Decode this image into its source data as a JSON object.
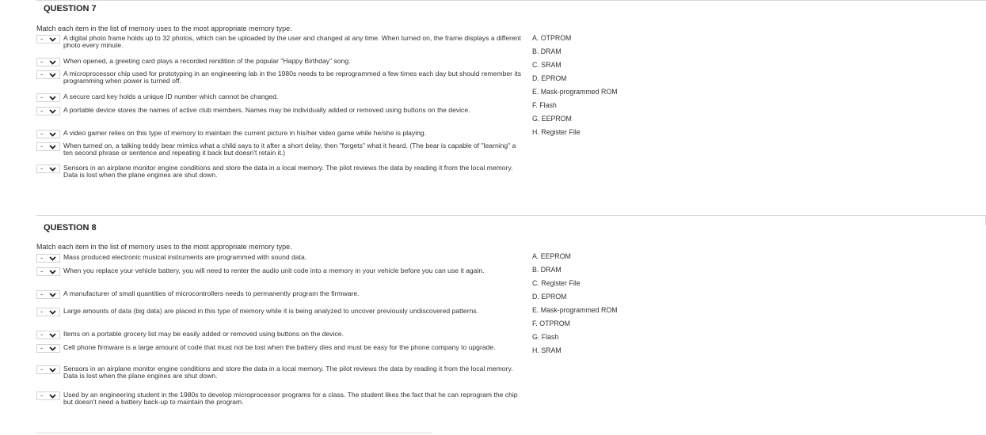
{
  "q7": {
    "title": "QUESTION 7",
    "instruction": "Match each item in the list of memory uses to the most appropriate memory type.",
    "items": [
      {
        "sel": "-",
        "text": "A digital photo frame holds up to 32 photos, which can be uploaded by the user and changed at any time. When turned on, the frame displays a different photo every minute."
      },
      {
        "sel": "-",
        "text": "When opened, a greeting card plays a recorded rendition of the popular \"Happy Birthday\" song."
      },
      {
        "sel": "-",
        "text": "A microprocessor chip used for prototyping in an engineering lab in the 1980s needs to be reprogrammed a few times each day but should remember its programming when power is turned off."
      },
      {
        "sel": "-",
        "text": "A secure card key holds a unique ID number which cannot be changed."
      },
      {
        "sel": "-",
        "text": "A portable device stores the names of active club members. Names may be individually added or removed using buttons on the device."
      },
      {
        "sel": "-",
        "text": "A video gamer relies on this type of memory to maintain the current picture in his/her video game while he/she is playing."
      },
      {
        "sel": "-",
        "text": "When turned on, a talking teddy bear mimics what a child says to it after a short delay, then \"forgets\" what it heard. (The bear is capable of \"learning\" a ten second phrase or sentence and repeating it back but doesn't retain it.)"
      },
      {
        "sel": "-",
        "text": "Sensors in an airplane monitor engine conditions and store the data in a local memory. The pilot reviews the data by reading it from the local memory. Data is lost when the plane engines are shut down."
      }
    ],
    "answers": [
      "A. OTPROM",
      "B. DRAM",
      "C. SRAM",
      "D. EPROM",
      "E. Mask-programmed ROM",
      "F. Flash",
      "G. EEPROM",
      "H. Register File"
    ]
  },
  "q8": {
    "title": "QUESTION 8",
    "instruction": "Match each item in the list of memory uses to the most appropriate memory type.",
    "items": [
      {
        "sel": "-",
        "text": "Mass produced electronic musical instruments are programmed with sound data."
      },
      {
        "sel": "-",
        "text": "When you replace your vehicle battery, you will need to renter the audio unit code into a memory in your vehicle before you can use it again."
      },
      {
        "sel": "-",
        "text": "A manufacturer of small quantities of microcontrollers needs to permanently program the firmware."
      },
      {
        "sel": "-",
        "text": "Large amounts of data (big data) are placed in this type of memory while it is being analyzed to uncover previously undiscovered patterns."
      },
      {
        "sel": "-",
        "text": "Items on a portable grocery list may be easily added or removed using buttons on the device."
      },
      {
        "sel": "-",
        "text": "Cell phone firmware is a large amount of code that must not be lost when the battery dies and must be easy for the phone company to upgrade."
      },
      {
        "sel": "-",
        "text": "Sensors in an airplane monitor engine conditions and store the data in a local memory. The pilot reviews the data by reading it from the local memory. Data is lost when the plane engines are shut down."
      },
      {
        "sel": "-",
        "text": "Used by an engineering student in the 1980s to develop microprocessor programs for a class. The student likes the fact that he can reprogram the chip but doesn't need a battery back-up to maintain the program."
      }
    ],
    "answers": [
      "A. EEPROM",
      "B. DRAM",
      "C. Register File",
      "D. EPROM",
      "E. Mask-programmed ROM",
      "F. OTPROM",
      "G. Flash",
      "H. SRAM"
    ]
  }
}
